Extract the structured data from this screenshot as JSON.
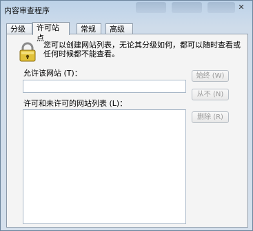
{
  "window": {
    "title": "内容审查程序",
    "close_glyph": "✕"
  },
  "tabs": [
    {
      "label": "分级"
    },
    {
      "label": "许可站点"
    },
    {
      "label": "常规"
    },
    {
      "label": "高级"
    }
  ],
  "main": {
    "description": "您可以创建网站列表，无论其分级如何，都可以随时查看或任何时候都不能查看。",
    "allow_site_label": "允许该网站 (T)：",
    "allow_site_value": "",
    "list_label": "许可和未许可的网站列表 (L)：",
    "buttons": {
      "always": "始终 (W)",
      "never": "从不 (N)",
      "delete": "删除 (R)"
    }
  },
  "colors": {
    "accent": "#8d9aa8",
    "button_text_disabled": "#9a9a9a"
  }
}
